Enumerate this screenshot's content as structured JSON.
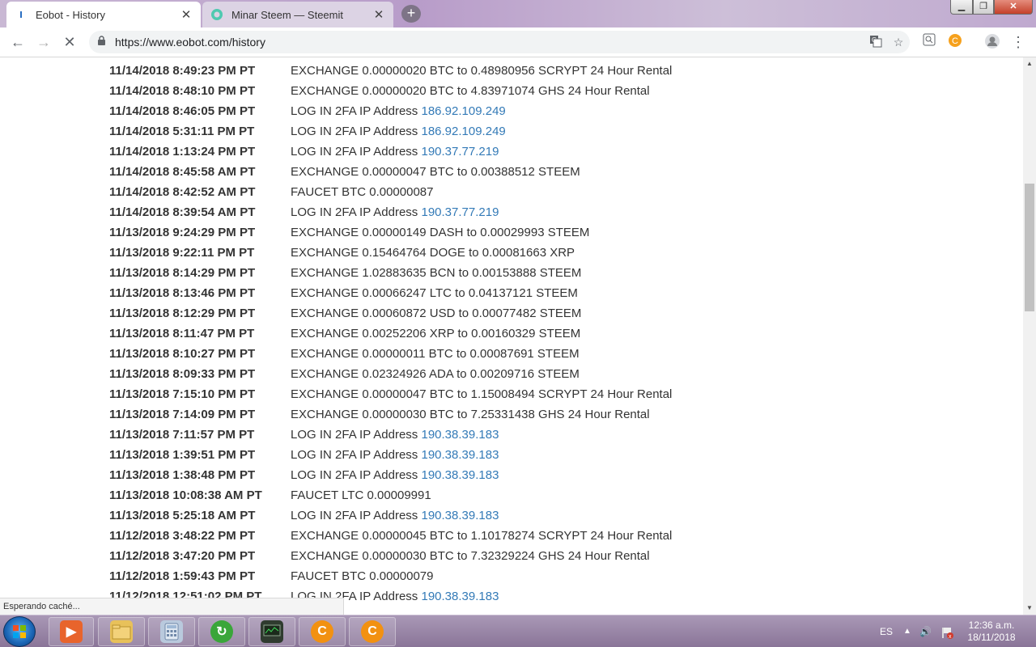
{
  "browser": {
    "tabs": [
      {
        "label": "Eobot - History",
        "favicon": "eobot-favicon"
      },
      {
        "label": "Minar Steem — Steemit",
        "favicon": "steemit-favicon"
      }
    ],
    "url": "https://www.eobot.com/history",
    "status": "Esperando caché..."
  },
  "history": [
    {
      "date": "11/14/2018 8:49:23 PM PT",
      "text": "EXCHANGE 0.00000020 BTC to 0.48980956 SCRYPT 24 Hour Rental",
      "ip": ""
    },
    {
      "date": "11/14/2018 8:48:10 PM PT",
      "text": "EXCHANGE 0.00000020 BTC to 4.83971074 GHS 24 Hour Rental",
      "ip": ""
    },
    {
      "date": "11/14/2018 8:46:05 PM PT",
      "text": "LOG IN 2FA IP Address ",
      "ip": "186.92.109.249"
    },
    {
      "date": "11/14/2018 5:31:11 PM PT",
      "text": "LOG IN 2FA IP Address ",
      "ip": "186.92.109.249"
    },
    {
      "date": "11/14/2018 1:13:24 PM PT",
      "text": "LOG IN 2FA IP Address ",
      "ip": "190.37.77.219"
    },
    {
      "date": "11/14/2018 8:45:58 AM PT",
      "text": "EXCHANGE 0.00000047 BTC to 0.00388512 STEEM",
      "ip": ""
    },
    {
      "date": "11/14/2018 8:42:52 AM PT",
      "text": "FAUCET BTC 0.00000087",
      "ip": ""
    },
    {
      "date": "11/14/2018 8:39:54 AM PT",
      "text": "LOG IN 2FA IP Address ",
      "ip": "190.37.77.219"
    },
    {
      "date": "11/13/2018 9:24:29 PM PT",
      "text": "EXCHANGE 0.00000149 DASH to 0.00029993 STEEM",
      "ip": ""
    },
    {
      "date": "11/13/2018 9:22:11 PM PT",
      "text": "EXCHANGE 0.15464764 DOGE to 0.00081663 XRP",
      "ip": ""
    },
    {
      "date": "11/13/2018 8:14:29 PM PT",
      "text": "EXCHANGE 1.02883635 BCN to 0.00153888 STEEM",
      "ip": ""
    },
    {
      "date": "11/13/2018 8:13:46 PM PT",
      "text": "EXCHANGE 0.00066247 LTC to 0.04137121 STEEM",
      "ip": ""
    },
    {
      "date": "11/13/2018 8:12:29 PM PT",
      "text": "EXCHANGE 0.00060872 USD to 0.00077482 STEEM",
      "ip": ""
    },
    {
      "date": "11/13/2018 8:11:47 PM PT",
      "text": "EXCHANGE 0.00252206 XRP to 0.00160329 STEEM",
      "ip": ""
    },
    {
      "date": "11/13/2018 8:10:27 PM PT",
      "text": "EXCHANGE 0.00000011 BTC to 0.00087691 STEEM",
      "ip": ""
    },
    {
      "date": "11/13/2018 8:09:33 PM PT",
      "text": "EXCHANGE 0.02324926 ADA to 0.00209716 STEEM",
      "ip": ""
    },
    {
      "date": "11/13/2018 7:15:10 PM PT",
      "text": "EXCHANGE 0.00000047 BTC to 1.15008494 SCRYPT 24 Hour Rental",
      "ip": ""
    },
    {
      "date": "11/13/2018 7:14:09 PM PT",
      "text": "EXCHANGE 0.00000030 BTC to 7.25331438 GHS 24 Hour Rental",
      "ip": ""
    },
    {
      "date": "11/13/2018 7:11:57 PM PT",
      "text": "LOG IN 2FA IP Address ",
      "ip": "190.38.39.183"
    },
    {
      "date": "11/13/2018 1:39:51 PM PT",
      "text": "LOG IN 2FA IP Address ",
      "ip": "190.38.39.183"
    },
    {
      "date": "11/13/2018 1:38:48 PM PT",
      "text": "LOG IN 2FA IP Address ",
      "ip": "190.38.39.183"
    },
    {
      "date": "11/13/2018 10:08:38 AM PT",
      "text": "FAUCET LTC 0.00009991",
      "ip": ""
    },
    {
      "date": "11/13/2018 5:25:18 AM PT",
      "text": "LOG IN 2FA IP Address ",
      "ip": "190.38.39.183"
    },
    {
      "date": "11/12/2018 3:48:22 PM PT",
      "text": "EXCHANGE 0.00000045 BTC to 1.10178274 SCRYPT 24 Hour Rental",
      "ip": ""
    },
    {
      "date": "11/12/2018 3:47:20 PM PT",
      "text": "EXCHANGE 0.00000030 BTC to 7.32329224 GHS 24 Hour Rental",
      "ip": ""
    },
    {
      "date": "11/12/2018 1:59:43 PM PT",
      "text": "FAUCET BTC 0.00000079",
      "ip": ""
    },
    {
      "date": "11/12/2018 12:51:02 PM PT",
      "text": "LOG IN 2FA IP Address ",
      "ip": "190.38.39.183"
    }
  ],
  "taskbar": {
    "language": "ES",
    "time": "12:36 a.m.",
    "date": "18/11/2018"
  }
}
